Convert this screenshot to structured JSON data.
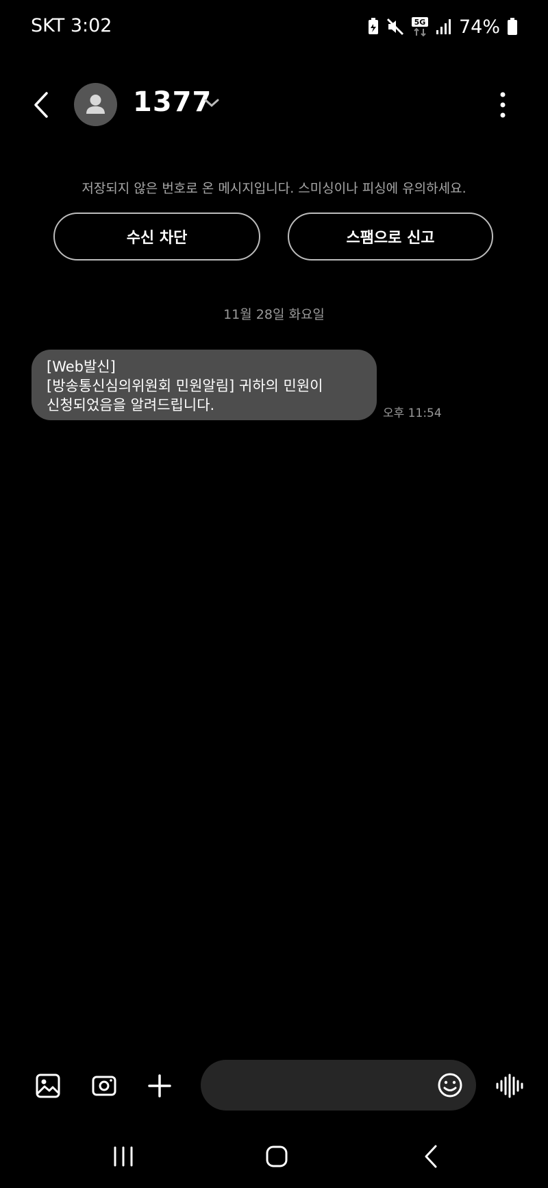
{
  "status_bar": {
    "carrier_time": "SKT 3:02",
    "network": "5G",
    "battery": "74%"
  },
  "header": {
    "contact_name": "1377",
    "icons": [
      "back-arrow-icon",
      "avatar-icon",
      "chevron-down-icon",
      "more-vert-icon"
    ]
  },
  "warning": {
    "text": "저장되지 않은 번호로 온 메시지입니다. 스미싱이나 피싱에 유의하세요.",
    "block_label": "수신 차단",
    "spam_label": "스팸으로 신고"
  },
  "conversation": {
    "date_label": "11월 28일 화요일",
    "messages": [
      {
        "lines": [
          "[Web발신]",
          "[방송통신심의위원회 민원알림] 귀하의 민원이",
          "신청되었음을 알려드립니다."
        ],
        "time": "오후 11:54"
      }
    ]
  },
  "composer": {
    "placeholder": "",
    "icons": [
      "gallery-icon",
      "camera-icon",
      "plus-icon",
      "emoji-icon",
      "voice-icon"
    ]
  },
  "nav_bar": {
    "icons": [
      "recent-apps-icon",
      "home-icon",
      "back-icon"
    ]
  },
  "colors": {
    "background": "#000000",
    "bubble": "#4d4d4d",
    "input_field": "#262626",
    "muted_text": "#9a9a9a",
    "button_border": "#bdbdbd"
  }
}
